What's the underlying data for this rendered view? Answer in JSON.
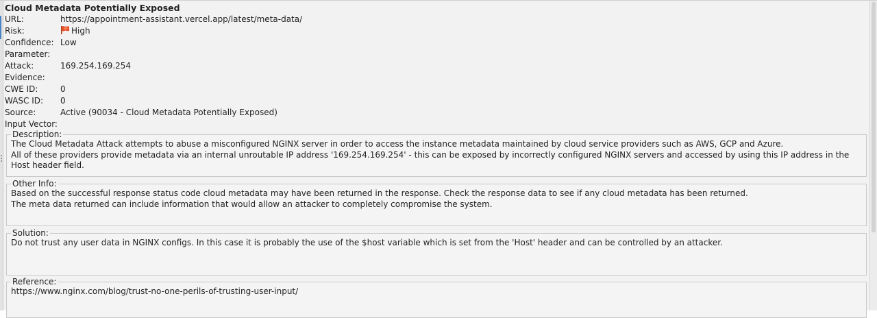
{
  "alert": {
    "title": "Cloud Metadata Potentially Exposed",
    "fields": [
      {
        "label": "URL:",
        "value": "https://appointment-assistant.vercel.app/latest/meta-data/"
      },
      {
        "label": "Risk:",
        "value": "High",
        "icon": "high-risk-flag-icon"
      },
      {
        "label": "Confidence:",
        "value": "Low"
      },
      {
        "label": "Parameter:",
        "value": ""
      },
      {
        "label": "Attack:",
        "value": "169.254.169.254"
      },
      {
        "label": "Evidence:",
        "value": ""
      },
      {
        "label": "CWE ID:",
        "value": "0"
      },
      {
        "label": "WASC ID:",
        "value": "0"
      },
      {
        "label": "Source:",
        "value": "Active (90034 - Cloud Metadata Potentially Exposed)"
      },
      {
        "label": "Input Vector:",
        "value": ""
      }
    ],
    "description": {
      "label": "Description:",
      "text": "The Cloud Metadata Attack attempts to abuse a misconfigured NGINX server in order to access the instance metadata maintained by cloud service providers such as AWS, GCP and Azure.\nAll of these providers provide metadata via an internal unroutable IP address '169.254.169.254' - this can be exposed by incorrectly configured NGINX servers and accessed by using this IP address in the Host header field."
    },
    "other_info": {
      "label": "Other Info:",
      "text": "Based on the successful response status code cloud metadata may have been returned in the response. Check the response data to see if any cloud metadata has been returned.\nThe meta data returned can include information that would allow an attacker to completely compromise the system."
    },
    "solution": {
      "label": "Solution:",
      "text": "Do not trust any user data in NGINX configs. In this case it is probably the use of the $host variable which is set from the 'Host' header and can be controlled by an attacker."
    },
    "reference": {
      "label": "Reference:",
      "text": "https://www.nginx.com/blog/trust-no-one-perils-of-trusting-user-input/"
    }
  },
  "colors": {
    "panel_bg": "#f2f2f2",
    "box_border": "#c9c9c9",
    "risk_high": "#e8502a"
  }
}
